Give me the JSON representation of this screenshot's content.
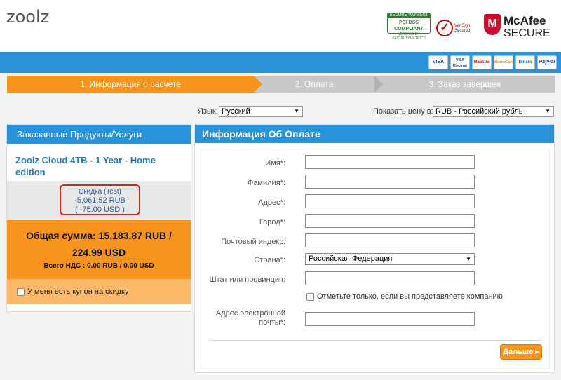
{
  "header": {
    "logo": "zoolz",
    "badges": {
      "pci_top": "SECURE PAYMENT",
      "pci_mid": "PCI DSS COMPLIANT",
      "pci_bot": "VERIFIED BY SECURITYMETRICS",
      "verisign_1": "VeriSign",
      "verisign_2": "Secured",
      "mcafee_1": "McAfee",
      "mcafee_2": "SECURE"
    }
  },
  "payment_cards": [
    "VISA",
    "VISA Electron",
    "Maestro",
    "MasterCard",
    "Diners",
    "PayPal"
  ],
  "steps": [
    {
      "label": "1. Информация о расчете",
      "active": true
    },
    {
      "label": "2. Оплата",
      "active": false
    },
    {
      "label": "3. Заказ завершен",
      "active": false
    }
  ],
  "language": {
    "label": "Язык:",
    "value": "Русский"
  },
  "currency": {
    "label": "Показать цену в:",
    "value": "RUB - Российский рубль"
  },
  "order": {
    "heading": "Заказанные Продукты/Услуги",
    "product": "Zoolz Cloud 4TB - 1 Year - Home edition",
    "discount_label": "Скидка (Test)",
    "discount_rub": "-5,061.52 RUB",
    "discount_usd": "( -75.00 USD )",
    "total_line1": "Общая сумма: 15,183.87 RUB /",
    "total_line2": "224.99 USD",
    "vat": "Всего НДС : 0.00 RUB / 0.00 USD",
    "coupon": "У меня есть купон на скидку"
  },
  "billing": {
    "heading": "Информация Об Оплате",
    "fields": {
      "first_name": "Имя*:",
      "last_name": "Фамилия*:",
      "address": "Адрес*:",
      "city": "Город*:",
      "zip": "Почтовый индекс:",
      "country": "Страна*:",
      "state": "Штат или провинция:",
      "email_1": "Адрес электронной",
      "email_2": "почты*:"
    },
    "country_value": "Российская Федерация",
    "company_check": "Отметьте только, если вы представляете компанию",
    "next_button": "Дальше ▸"
  },
  "colors": {
    "accent_blue": "#2a92d8",
    "accent_orange": "#f7941d",
    "discount_border": "#e02020"
  }
}
